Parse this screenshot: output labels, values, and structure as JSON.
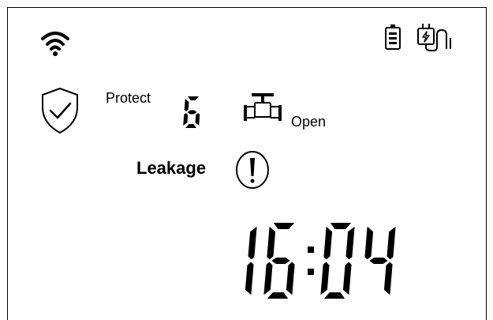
{
  "status_bar": {
    "wifi_icon": "wifi-icon",
    "battery_icon": "battery-icon",
    "charging_icon": "plug-charging-icon"
  },
  "protection": {
    "icon": "shield-check-icon",
    "label": "Protect",
    "level": "6"
  },
  "valve": {
    "icon": "valve-icon",
    "status": "Open"
  },
  "leakage": {
    "label": "Leakage",
    "icon": "exclamation-circle-icon"
  },
  "clock": {
    "time": "16:04"
  }
}
